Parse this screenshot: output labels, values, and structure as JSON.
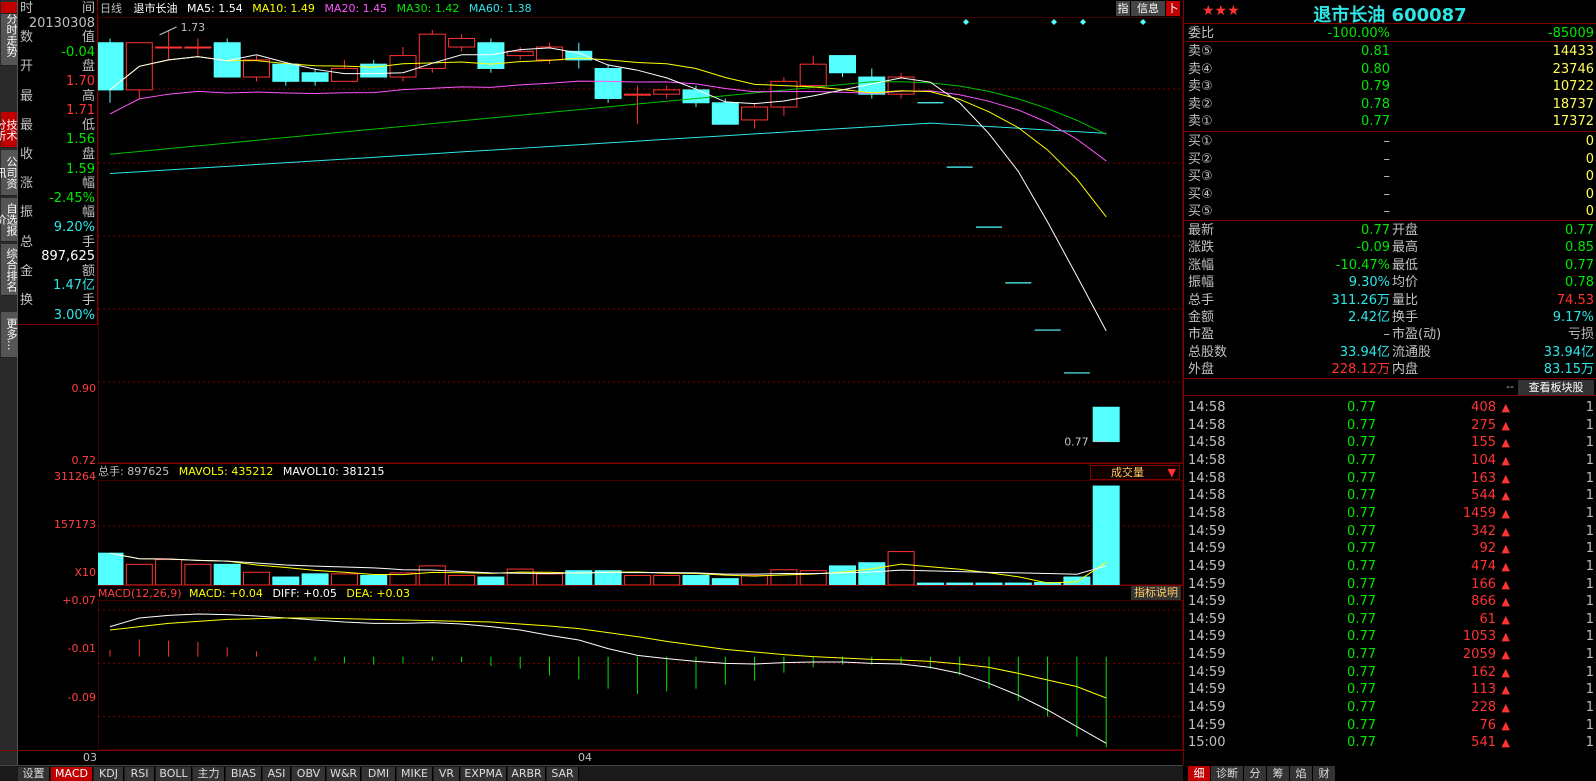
{
  "vtabs": [
    "分时走势",
    "技术分析",
    "公司资讯",
    "自选报价",
    "综合排名",
    "更多..."
  ],
  "info_rows": [
    {
      "l": "时",
      "r": "间",
      "rc": "#c0c0c0"
    },
    {
      "l": "",
      "r": "20130308",
      "rc": "#c0c0c0"
    },
    {
      "l": "数",
      "r": "值",
      "rc": "#c0c0c0"
    },
    {
      "l": "",
      "r": "-0.04",
      "rc": "#00e600"
    },
    {
      "l": "开",
      "r": "盘",
      "rc": "#c0c0c0"
    },
    {
      "l": "",
      "r": "1.70",
      "rc": "#ff3333"
    },
    {
      "l": "最",
      "r": "高",
      "rc": "#c0c0c0"
    },
    {
      "l": "",
      "r": "1.71",
      "rc": "#ff3333"
    },
    {
      "l": "最",
      "r": "低",
      "rc": "#c0c0c0"
    },
    {
      "l": "",
      "r": "1.56",
      "rc": "#00e600"
    },
    {
      "l": "收",
      "r": "盘",
      "rc": "#c0c0c0"
    },
    {
      "l": "",
      "r": "1.59",
      "rc": "#00e600"
    },
    {
      "l": "涨",
      "r": "幅",
      "rc": "#c0c0c0"
    },
    {
      "l": "",
      "r": "-2.45%",
      "rc": "#00e600"
    },
    {
      "l": "振",
      "r": "幅",
      "rc": "#c0c0c0"
    },
    {
      "l": "",
      "r": "9.20%",
      "rc": "#2ee6e6"
    },
    {
      "l": "总",
      "r": "手",
      "rc": "#c0c0c0"
    },
    {
      "l": "",
      "r": "897,625",
      "rc": "#ffffff"
    },
    {
      "l": "金",
      "r": "额",
      "rc": "#c0c0c0"
    },
    {
      "l": "",
      "r": "1.47亿",
      "rc": "#2ee6e6"
    },
    {
      "l": "换",
      "r": "手",
      "rc": "#c0c0c0"
    },
    {
      "l": "",
      "r": "3.00%",
      "rc": "#2ee6e6"
    }
  ],
  "header": {
    "period": "日线",
    "name": "退市长油",
    "ma5": "MA5: 1.54",
    "ma10": "MA10: 1.49",
    "ma20": "MA20: 1.45",
    "ma30": "MA30: 1.42",
    "ma60": "MA60: 1.38",
    "btn_index": "指",
    "btn_info": "信息",
    "btn_expand": "卜"
  },
  "price_axis": {
    "p1": "0.90",
    "p2": "0.72"
  },
  "annot": {
    "high": "1.73",
    "low": "0.77"
  },
  "vol": {
    "title": "总手: 897625",
    "mavol5": "MAVOL5: 435212",
    "mavol10": "MAVOL10: 381215",
    "y1": "311264",
    "y2": "157173",
    "unit": "X10",
    "dropdown": "成交量"
  },
  "macd": {
    "title": "MACD(12,26,9)",
    "macd": "MACD: +0.04",
    "diff": "DIFF: +0.05",
    "dea": "DEA: +0.03",
    "y1": "+0.07",
    "y2": "-0.01",
    "y3": "-0.09",
    "help": "指标说明"
  },
  "xaxis": {
    "m1": "03",
    "m2": "04"
  },
  "toolbar": [
    "设置",
    "MACD",
    "KDJ",
    "RSI",
    "BOLL",
    "主力",
    "BIAS",
    "ASI",
    "OBV",
    "W&R",
    "DMI",
    "MIKE",
    "VR",
    "EXPMA",
    "ARBR",
    "SAR"
  ],
  "stock": {
    "stars": "★★★",
    "title": "退市长油 600087"
  },
  "weibi": {
    "label": "委比",
    "pct": "-100.00%",
    "diff": "-85009"
  },
  "sells": [
    {
      "label": "卖⑤",
      "price": "0.81",
      "vol": "14433"
    },
    {
      "label": "卖④",
      "price": "0.80",
      "vol": "23746"
    },
    {
      "label": "卖③",
      "price": "0.79",
      "vol": "10722"
    },
    {
      "label": "卖②",
      "price": "0.78",
      "vol": "18737"
    },
    {
      "label": "卖①",
      "price": "0.77",
      "vol": "17372"
    }
  ],
  "buys": [
    {
      "label": "买①",
      "price": "–",
      "vol": "0"
    },
    {
      "label": "买②",
      "price": "–",
      "vol": "0"
    },
    {
      "label": "买③",
      "price": "–",
      "vol": "0"
    },
    {
      "label": "买④",
      "price": "–",
      "vol": "0"
    },
    {
      "label": "买⑤",
      "price": "–",
      "vol": "0"
    }
  ],
  "stats": [
    {
      "l1": "最新",
      "v1": "0.77",
      "c1": "#00e600",
      "l2": "开盘",
      "v2": "0.77",
      "c2": "#00e600"
    },
    {
      "l1": "涨跌",
      "v1": "-0.09",
      "c1": "#00e600",
      "l2": "最高",
      "v2": "0.85",
      "c2": "#00e600"
    },
    {
      "l1": "涨幅",
      "v1": "-10.47%",
      "c1": "#00e600",
      "l2": "最低",
      "v2": "0.77",
      "c2": "#00e600"
    },
    {
      "l1": "振幅",
      "v1": "9.30%",
      "c1": "#2ee6e6",
      "l2": "均价",
      "v2": "0.78",
      "c2": "#00e600"
    },
    {
      "l1": "总手",
      "v1": "311.26万",
      "c1": "#2ee6e6",
      "l2": "量比",
      "v2": "74.53",
      "c2": "#ff3333"
    },
    {
      "l1": "金额",
      "v1": "2.42亿",
      "c1": "#2ee6e6",
      "l2": "换手",
      "v2": "9.17%",
      "c2": "#2ee6e6"
    },
    {
      "l1": "市盈",
      "v1": "–",
      "c1": "#c0c0c0",
      "l2": "市盈(动)",
      "v2": "亏损",
      "c2": "#c0c0c0"
    },
    {
      "l1": "总股数",
      "v1": "33.94亿",
      "c1": "#2ee6e6",
      "l2": "流通股",
      "v2": "33.94亿",
      "c2": "#2ee6e6"
    },
    {
      "l1": "外盘",
      "v1": "228.12万",
      "c1": "#ff3333",
      "l2": "内盘",
      "v2": "83.15万",
      "c2": "#2ee6e6"
    }
  ],
  "board_btn": {
    "dash": "--",
    "label": "查看板块股"
  },
  "trades": [
    {
      "t": "14:58",
      "p": "0.77",
      "v": "408",
      "n": "1"
    },
    {
      "t": "14:58",
      "p": "0.77",
      "v": "275",
      "n": "1"
    },
    {
      "t": "14:58",
      "p": "0.77",
      "v": "155",
      "n": "1"
    },
    {
      "t": "14:58",
      "p": "0.77",
      "v": "104",
      "n": "1"
    },
    {
      "t": "14:58",
      "p": "0.77",
      "v": "163",
      "n": "1"
    },
    {
      "t": "14:58",
      "p": "0.77",
      "v": "544",
      "n": "1"
    },
    {
      "t": "14:58",
      "p": "0.77",
      "v": "1459",
      "n": "1"
    },
    {
      "t": "14:59",
      "p": "0.77",
      "v": "342",
      "n": "1"
    },
    {
      "t": "14:59",
      "p": "0.77",
      "v": "92",
      "n": "1"
    },
    {
      "t": "14:59",
      "p": "0.77",
      "v": "474",
      "n": "1"
    },
    {
      "t": "14:59",
      "p": "0.77",
      "v": "166",
      "n": "1"
    },
    {
      "t": "14:59",
      "p": "0.77",
      "v": "866",
      "n": "1"
    },
    {
      "t": "14:59",
      "p": "0.77",
      "v": "61",
      "n": "1"
    },
    {
      "t": "14:59",
      "p": "0.77",
      "v": "1053",
      "n": "1"
    },
    {
      "t": "14:59",
      "p": "0.77",
      "v": "2059",
      "n": "1"
    },
    {
      "t": "14:59",
      "p": "0.77",
      "v": "162",
      "n": "1"
    },
    {
      "t": "14:59",
      "p": "0.77",
      "v": "113",
      "n": "1"
    },
    {
      "t": "14:59",
      "p": "0.77",
      "v": "228",
      "n": "1"
    },
    {
      "t": "14:59",
      "p": "0.77",
      "v": "76",
      "n": "1"
    },
    {
      "t": "15:00",
      "p": "0.77",
      "v": "541",
      "n": "1"
    }
  ],
  "rtabs": [
    "细",
    "诊断",
    "分",
    "筹",
    "焰",
    "财"
  ],
  "chart_data": {
    "type": "candlestick",
    "candles": [
      {
        "o": 1.7,
        "c": 1.59,
        "h": 1.71,
        "l": 1.56
      },
      {
        "o": 1.59,
        "c": 1.7,
        "h": 1.7,
        "l": 1.57
      },
      {
        "o": 1.69,
        "c": 1.69,
        "h": 1.73,
        "l": 1.66
      },
      {
        "o": 1.69,
        "c": 1.69,
        "h": 1.71,
        "l": 1.67
      },
      {
        "o": 1.7,
        "c": 1.62,
        "h": 1.71,
        "l": 1.62
      },
      {
        "o": 1.62,
        "c": 1.66,
        "h": 1.67,
        "l": 1.61
      },
      {
        "o": 1.65,
        "c": 1.61,
        "h": 1.65,
        "l": 1.6
      },
      {
        "o": 1.63,
        "c": 1.61,
        "h": 1.64,
        "l": 1.6
      },
      {
        "o": 1.61,
        "c": 1.64,
        "h": 1.66,
        "l": 1.61
      },
      {
        "o": 1.65,
        "c": 1.62,
        "h": 1.66,
        "l": 1.62
      },
      {
        "o": 1.62,
        "c": 1.67,
        "h": 1.69,
        "l": 1.61
      },
      {
        "o": 1.64,
        "c": 1.72,
        "h": 1.73,
        "l": 1.63
      },
      {
        "o": 1.69,
        "c": 1.71,
        "h": 1.72,
        "l": 1.68
      },
      {
        "o": 1.7,
        "c": 1.64,
        "h": 1.71,
        "l": 1.63
      },
      {
        "o": 1.67,
        "c": 1.68,
        "h": 1.69,
        "l": 1.66
      },
      {
        "o": 1.66,
        "c": 1.69,
        "h": 1.7,
        "l": 1.65
      },
      {
        "o": 1.68,
        "c": 1.66,
        "h": 1.7,
        "l": 1.64
      },
      {
        "o": 1.64,
        "c": 1.57,
        "h": 1.65,
        "l": 1.56
      },
      {
        "o": 1.58,
        "c": 1.58,
        "h": 1.6,
        "l": 1.51
      },
      {
        "o": 1.58,
        "c": 1.59,
        "h": 1.6,
        "l": 1.57
      },
      {
        "o": 1.59,
        "c": 1.56,
        "h": 1.6,
        "l": 1.55
      },
      {
        "o": 1.56,
        "c": 1.51,
        "h": 1.57,
        "l": 1.51
      },
      {
        "o": 1.52,
        "c": 1.55,
        "h": 1.56,
        "l": 1.5
      },
      {
        "o": 1.55,
        "c": 1.61,
        "h": 1.62,
        "l": 1.53
      },
      {
        "o": 1.6,
        "c": 1.65,
        "h": 1.67,
        "l": 1.6
      },
      {
        "o": 1.67,
        "c": 1.63,
        "h": 1.67,
        "l": 1.62
      },
      {
        "o": 1.62,
        "c": 1.58,
        "h": 1.64,
        "l": 1.57
      },
      {
        "o": 1.58,
        "c": 1.62,
        "h": 1.63,
        "l": 1.57
      },
      {
        "o": 1.56,
        "c": 1.56,
        "h": 1.56,
        "l": 1.56
      },
      {
        "o": 1.41,
        "c": 1.41,
        "h": 1.41,
        "l": 1.41
      },
      {
        "o": 1.27,
        "c": 1.27,
        "h": 1.27,
        "l": 1.27
      },
      {
        "o": 1.14,
        "c": 1.14,
        "h": 1.14,
        "l": 1.14
      },
      {
        "o": 1.03,
        "c": 1.03,
        "h": 1.03,
        "l": 1.03
      },
      {
        "o": 0.93,
        "c": 0.93,
        "h": 0.93,
        "l": 0.93
      },
      {
        "o": 0.85,
        "c": 0.77,
        "h": 0.85,
        "l": 0.77
      }
    ],
    "ylim": [
      0.72,
      1.76
    ],
    "price_ticks": [
      0.9,
      0.72
    ],
    "volume": [
      100,
      65,
      80,
      65,
      65,
      40,
      25,
      35,
      35,
      30,
      38,
      60,
      30,
      25,
      50,
      35,
      45,
      45,
      30,
      30,
      30,
      20,
      30,
      48,
      45,
      60,
      70,
      105,
      6,
      6,
      6,
      6,
      8,
      25,
      311
    ],
    "vol_max": 330,
    "macd": {
      "diff": [
        0.045,
        0.058,
        0.062,
        0.064,
        0.063,
        0.061,
        0.058,
        0.055,
        0.052,
        0.05,
        0.05,
        0.051,
        0.049,
        0.045,
        0.04,
        0.032,
        0.025,
        0.012,
        0.002,
        -0.003,
        -0.007,
        -0.01,
        -0.011,
        -0.009,
        -0.008,
        -0.008,
        -0.01,
        -0.011,
        -0.016,
        -0.025,
        -0.04,
        -0.058,
        -0.08,
        -0.105,
        -0.13
      ],
      "dea": [
        0.04,
        0.045,
        0.05,
        0.053,
        0.056,
        0.057,
        0.058,
        0.058,
        0.057,
        0.056,
        0.055,
        0.054,
        0.053,
        0.052,
        0.049,
        0.046,
        0.042,
        0.036,
        0.03,
        0.023,
        0.017,
        0.011,
        0.007,
        0.003,
        0.0,
        -0.002,
        -0.004,
        -0.005,
        -0.007,
        -0.011,
        -0.016,
        -0.025,
        -0.035,
        -0.045,
        -0.062
      ],
      "ylim": [
        -0.14,
        0.085
      ]
    }
  }
}
